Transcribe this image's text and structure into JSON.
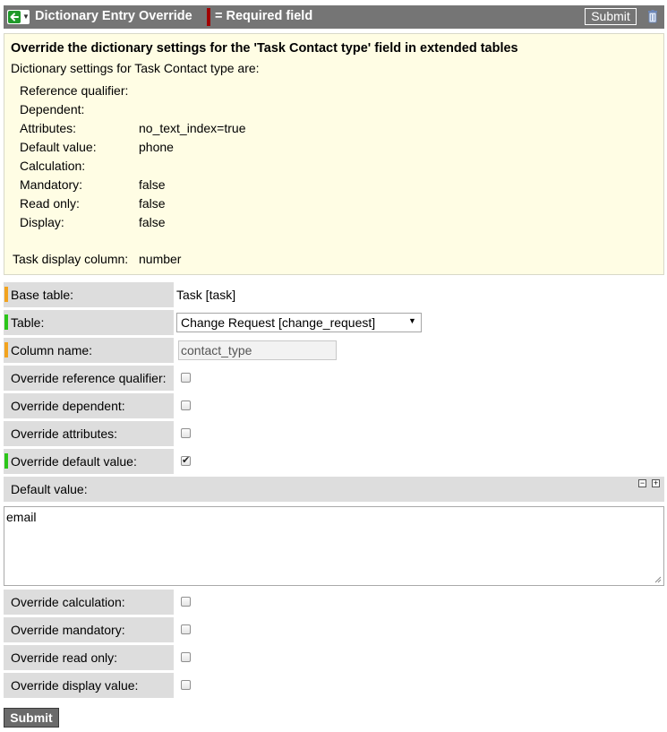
{
  "header": {
    "back_icon": "back-arrow-icon",
    "title": "Dictionary Entry Override",
    "required_legend": "= Required field",
    "submit_label": "Submit",
    "delete_icon": "trash-icon",
    "background_color": "#757575",
    "required_color": "#a00000"
  },
  "info": {
    "title": "Override the dictionary settings for the 'Task Contact type' field in extended tables",
    "subtitle": "Dictionary settings for Task Contact type are:",
    "settings": [
      {
        "label": "Reference qualifier:",
        "value": ""
      },
      {
        "label": "Dependent:",
        "value": ""
      },
      {
        "label": "Attributes:",
        "value": "no_text_index=true"
      },
      {
        "label": "Default value:",
        "value": "phone"
      },
      {
        "label": "Calculation:",
        "value": ""
      },
      {
        "label": "Mandatory:",
        "value": "false"
      },
      {
        "label": "Read only:",
        "value": "false"
      },
      {
        "label": "Display:",
        "value": "false"
      }
    ],
    "task_display_column_label": "Task display column:",
    "task_display_column_value": "number",
    "background_color": "#fffde4"
  },
  "form": {
    "base_table_label": "Base table:",
    "base_table_value": "Task [task]",
    "table_label": "Table:",
    "table_value": "Change Request [change_request]",
    "column_name_label": "Column name:",
    "column_name_value": "contact_type",
    "override_reference_qualifier_label": "Override reference qualifier:",
    "override_reference_qualifier_checked": false,
    "override_dependent_label": "Override dependent:",
    "override_dependent_checked": false,
    "override_attributes_label": "Override attributes:",
    "override_attributes_checked": false,
    "override_default_value_label": "Override default value:",
    "override_default_value_checked": true,
    "default_value_label": "Default value:",
    "default_value_text": "email",
    "override_calculation_label": "Override calculation:",
    "override_calculation_checked": false,
    "override_mandatory_label": "Override mandatory:",
    "override_mandatory_checked": false,
    "override_read_only_label": "Override read only:",
    "override_read_only_checked": false,
    "override_display_value_label": "Override display value:",
    "override_display_value_checked": false,
    "submit_label": "Submit",
    "mandatory_marker_color": "#f2a31f",
    "satisfied_marker_color": "#2cc51a"
  }
}
